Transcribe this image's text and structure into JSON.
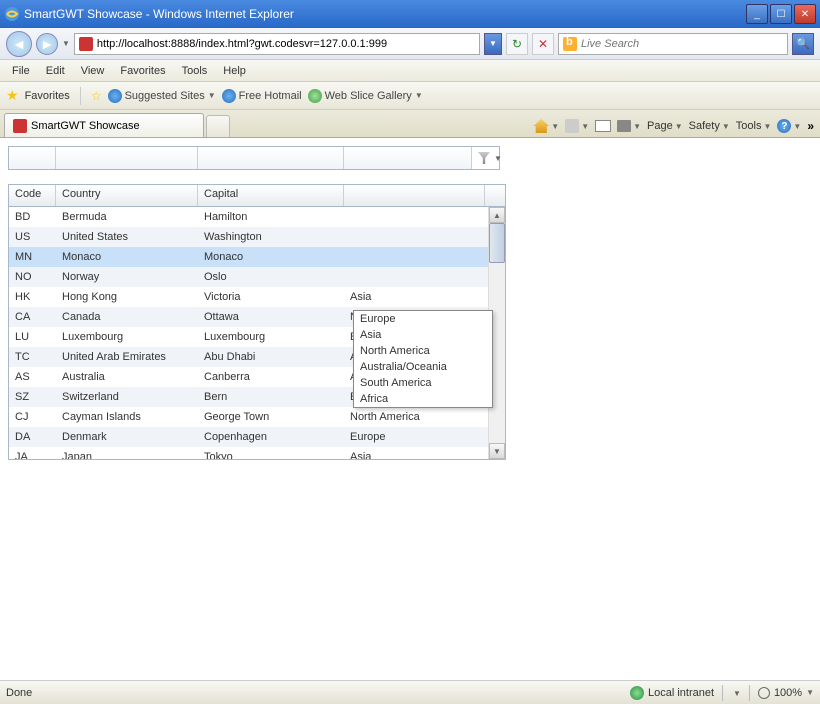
{
  "window": {
    "title": "SmartGWT Showcase - Windows Internet Explorer"
  },
  "nav": {
    "url": "http://localhost:8888/index.html?gwt.codesvr=127.0.0.1:999",
    "search_placeholder": "Live Search"
  },
  "menu": {
    "items": [
      "File",
      "Edit",
      "View",
      "Favorites",
      "Tools",
      "Help"
    ]
  },
  "favbar": {
    "favorites_label": "Favorites",
    "suggested": "Suggested Sites",
    "hotmail": "Free Hotmail",
    "webslice": "Web Slice Gallery"
  },
  "tab": {
    "title": "SmartGWT Showcase"
  },
  "toolbar": {
    "page": "Page",
    "safety": "Safety",
    "tools": "Tools"
  },
  "grid": {
    "headers": {
      "code": "Code",
      "country": "Country",
      "capital": "Capital",
      "continent": ""
    },
    "rows": [
      {
        "code": "BD",
        "country": "Bermuda",
        "capital": "Hamilton",
        "continent": ""
      },
      {
        "code": "US",
        "country": "United States",
        "capital": "Washington",
        "continent": ""
      },
      {
        "code": "MN",
        "country": "Monaco",
        "capital": "Monaco",
        "continent": "",
        "selected": true
      },
      {
        "code": "NO",
        "country": "Norway",
        "capital": "Oslo",
        "continent": ""
      },
      {
        "code": "HK",
        "country": "Hong Kong",
        "capital": "Victoria",
        "continent": "Asia"
      },
      {
        "code": "CA",
        "country": "Canada",
        "capital": "Ottawa",
        "continent": "North America"
      },
      {
        "code": "LU",
        "country": "Luxembourg",
        "capital": "Luxembourg",
        "continent": "Europe"
      },
      {
        "code": "TC",
        "country": "United Arab Emirates",
        "capital": "Abu Dhabi",
        "continent": "Asia"
      },
      {
        "code": "AS",
        "country": "Australia",
        "capital": "Canberra",
        "continent": "Australia/Oceania"
      },
      {
        "code": "SZ",
        "country": "Switzerland",
        "capital": "Bern",
        "continent": "Europe"
      },
      {
        "code": "CJ",
        "country": "Cayman Islands",
        "capital": "George Town",
        "continent": "North America"
      },
      {
        "code": "DA",
        "country": "Denmark",
        "capital": "Copenhagen",
        "continent": "Europe"
      },
      {
        "code": "JA",
        "country": "Japan",
        "capital": "Tokyo",
        "continent": "Asia"
      }
    ]
  },
  "dropdown": {
    "options": [
      "Europe",
      "Asia",
      "North America",
      "Australia/Oceania",
      "South America",
      "Africa"
    ]
  },
  "status": {
    "text": "Done",
    "zone": "Local intranet",
    "zoom": "100%"
  }
}
